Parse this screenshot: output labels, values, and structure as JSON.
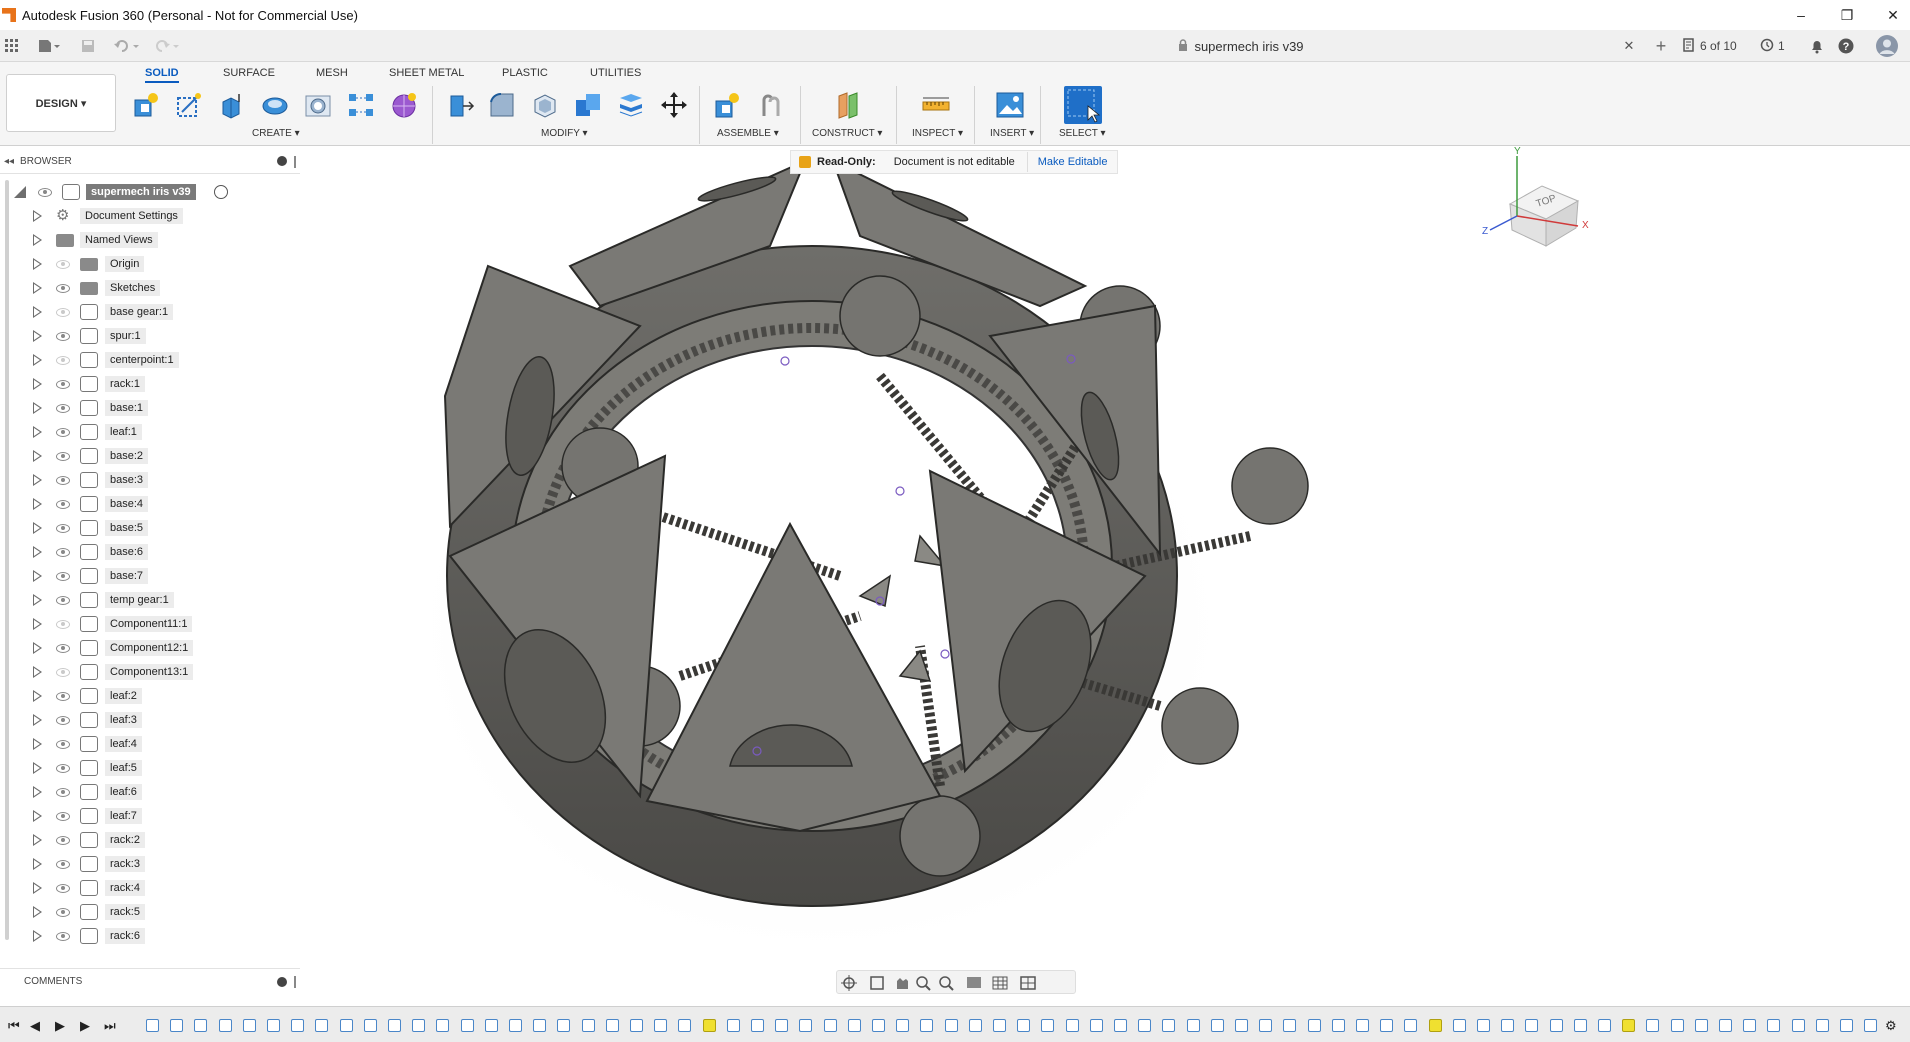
{
  "window": {
    "title": "Autodesk Fusion 360 (Personal - Not for Commercial Use)",
    "controls": [
      "–",
      "❐",
      "✕"
    ]
  },
  "quick_access": {
    "document_title": "supermech iris v39",
    "close_tab": "✕",
    "new_tab": "+",
    "versions": "6 of 10",
    "jobs": "1"
  },
  "toolbar": {
    "workspace": "DESIGN ▾",
    "tabs": [
      "SOLID",
      "SURFACE",
      "MESH",
      "SHEET METAL",
      "PLASTIC",
      "UTILITIES"
    ],
    "active_tab": "SOLID",
    "groups": {
      "create": "CREATE ▾",
      "modify": "MODIFY ▾",
      "assemble": "ASSEMBLE ▾",
      "construct": "CONSTRUCT ▾",
      "inspect": "INSPECT ▾",
      "insert": "INSERT ▾",
      "select": "SELECT ▾"
    }
  },
  "browser": {
    "header": "BROWSER",
    "root": "supermech iris v39",
    "items": [
      {
        "label": "Document Settings",
        "type": "gear"
      },
      {
        "label": "Named Views",
        "type": "folder"
      },
      {
        "label": "Origin",
        "type": "folder",
        "visible": false
      },
      {
        "label": "Sketches",
        "type": "folder",
        "visible": true
      },
      {
        "label": "base gear:1",
        "type": "comp",
        "visible": false
      },
      {
        "label": "spur:1",
        "type": "comp",
        "visible": true
      },
      {
        "label": "centerpoint:1",
        "type": "comp",
        "visible": false
      },
      {
        "label": "rack:1",
        "type": "comp",
        "visible": true
      },
      {
        "label": "base:1",
        "type": "comp",
        "visible": true
      },
      {
        "label": "leaf:1",
        "type": "comp",
        "visible": true
      },
      {
        "label": "base:2",
        "type": "comp",
        "visible": true
      },
      {
        "label": "base:3",
        "type": "comp",
        "visible": true
      },
      {
        "label": "base:4",
        "type": "comp",
        "visible": true
      },
      {
        "label": "base:5",
        "type": "comp",
        "visible": true
      },
      {
        "label": "base:6",
        "type": "comp",
        "visible": true
      },
      {
        "label": "base:7",
        "type": "comp",
        "visible": true
      },
      {
        "label": "temp gear:1",
        "type": "comp",
        "visible": true
      },
      {
        "label": "Component11:1",
        "type": "comp",
        "visible": false
      },
      {
        "label": "Component12:1",
        "type": "comp",
        "visible": true
      },
      {
        "label": "Component13:1",
        "type": "comp",
        "visible": false
      },
      {
        "label": "leaf:2",
        "type": "comp",
        "visible": true
      },
      {
        "label": "leaf:3",
        "type": "comp",
        "visible": true
      },
      {
        "label": "leaf:4",
        "type": "comp",
        "visible": true
      },
      {
        "label": "leaf:5",
        "type": "comp",
        "visible": true
      },
      {
        "label": "leaf:6",
        "type": "comp",
        "visible": true
      },
      {
        "label": "leaf:7",
        "type": "comp",
        "visible": true
      },
      {
        "label": "rack:2",
        "type": "comp",
        "visible": true
      },
      {
        "label": "rack:3",
        "type": "comp",
        "visible": true
      },
      {
        "label": "rack:4",
        "type": "comp",
        "visible": true
      },
      {
        "label": "rack:5",
        "type": "comp",
        "visible": true
      },
      {
        "label": "rack:6",
        "type": "comp",
        "visible": true
      }
    ]
  },
  "comments": {
    "header": "COMMENTS"
  },
  "readonly_banner": {
    "title": "Read-Only:",
    "message": "Document is not editable",
    "action": "Make Editable"
  },
  "viewcube": {
    "face": "TOP",
    "axis_x": "X",
    "axis_y": "Y",
    "axis_z": "Z"
  },
  "colors": {
    "accent": "#0a5bbf",
    "model": "#6b6a66",
    "highlight": "#f0e030"
  }
}
